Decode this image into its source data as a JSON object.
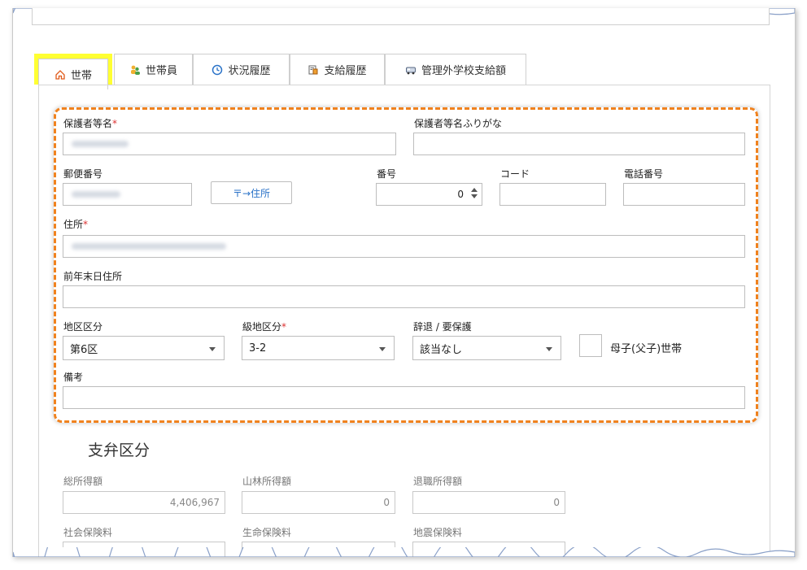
{
  "tabs": [
    {
      "label": "世帯",
      "icon": "home-icon",
      "active": true
    },
    {
      "label": "世帯員",
      "icon": "people-icon",
      "active": false
    },
    {
      "label": "状況履歴",
      "icon": "clock-icon",
      "active": false
    },
    {
      "label": "支給履歴",
      "icon": "ledger-icon",
      "active": false
    },
    {
      "label": "管理外学校支給額",
      "icon": "bus-icon",
      "active": false
    }
  ],
  "colors": {
    "highlight_tab": "#ffff33",
    "highlight_border": "#f0821e",
    "required": "#d33333",
    "link": "#2b73c8"
  },
  "form": {
    "guardian_name_label": "保護者等名",
    "guardian_kana_label": "保護者等名ふりがな",
    "postal_label": "郵便番号",
    "postal_button": "〒→住所",
    "number_label": "番号",
    "number_value": "0",
    "code_label": "コード",
    "phone_label": "電話番号",
    "address_label": "住所",
    "prev_address_label": "前年末日住所",
    "district_label": "地区区分",
    "district_value": "第6区",
    "grade_label": "級地区分",
    "grade_value": "3-2",
    "decline_label": "辞退 / 要保護",
    "decline_value": "該当なし",
    "single_parent_label": "母子(父子)世帯",
    "note_label": "備考",
    "required_mark": "*"
  },
  "payment": {
    "title": "支弁区分",
    "total_income_label": "総所得額",
    "total_income_value": "4,406,967",
    "forest_income_label": "山林所得額",
    "forest_income_value": "0",
    "retire_income_label": "退職所得額",
    "retire_income_value": "0",
    "social_ins_label": "社会保険料",
    "life_ins_label": "生命保険料",
    "quake_ins_label": "地震保険料"
  }
}
